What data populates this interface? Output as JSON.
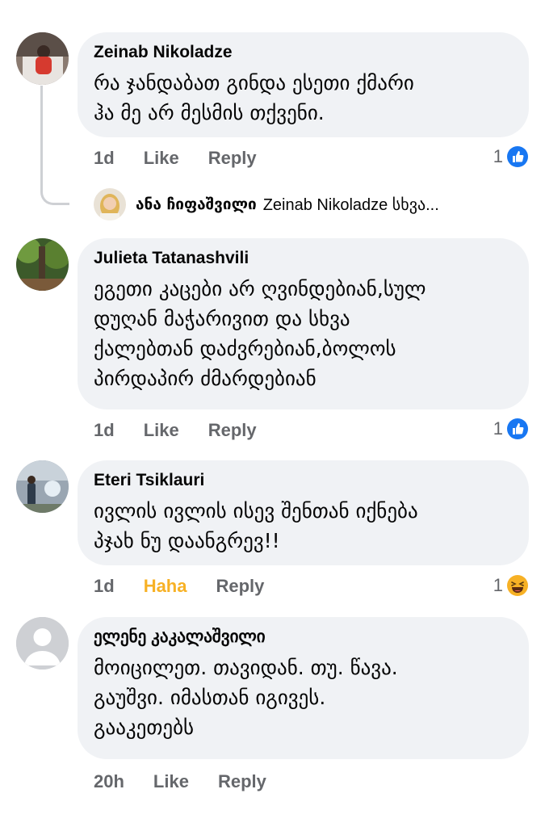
{
  "comments": [
    {
      "author": "Zeinab Nikoladze",
      "lines": [
        "რა ჯანდაბათ გინდა ესეთი ქმარი",
        "ჰა მე არ მესმის თქვენი."
      ],
      "time": "1d",
      "reaction_action": "Like",
      "reply": "Reply",
      "reaction_count": "1",
      "reaction_icon": "like-icon"
    },
    {
      "author": "Julieta Tatanashvili",
      "lines": [
        "ეგეთი კაცები არ ღვინდებიან,სულ",
        "დუღან მაჭარივით და სხვა",
        "ქალებთან დაძვრებიან,ბოლოს",
        "პირდაპირ ძმარდებიან"
      ],
      "time": "1d",
      "reaction_action": "Like",
      "reply": "Reply",
      "reaction_count": "1",
      "reaction_icon": "like-icon"
    },
    {
      "author": "Eteri Tsiklauri",
      "lines": [
        "ივლის ივლის ისევ შენთან იქნება",
        "პჯახ ნუ დაანგრევ!!"
      ],
      "time": "1d",
      "reaction_action": "Haha",
      "reply": "Reply",
      "reaction_count": "1",
      "reaction_icon": "haha-icon"
    },
    {
      "author": "ელენე კაკალაშვილი",
      "lines": [
        "მოიცილეთ. თავიდან.  თუ. წავა.",
        "გაუშვი. იმასთან   იგივეს.",
        "გააკეთებს"
      ],
      "time": "20h",
      "reaction_action": "Like",
      "reply": "Reply"
    }
  ],
  "reply_preview": {
    "author": "ანა ჩიფაშვილი",
    "text": "Zeinab Nikoladze სხვა..."
  },
  "colors": {
    "bubble": "#f0f2f5",
    "meta": "#65676b",
    "like_blue": "#1877f2",
    "haha": "#f7b125"
  }
}
